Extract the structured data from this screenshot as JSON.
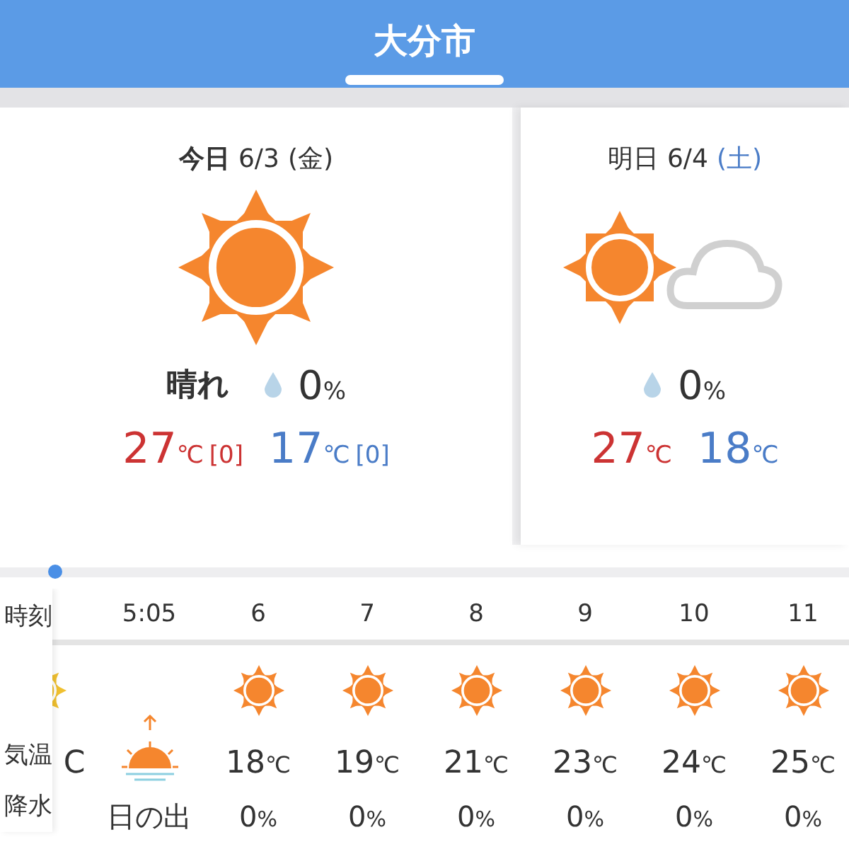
{
  "header": {
    "title": "大分市"
  },
  "days": [
    {
      "label": "今日",
      "date": "6/3",
      "weekday": "(金)",
      "color": "#333333",
      "kind": "sunny",
      "weather": "晴れ",
      "precip": "0",
      "precip_unit": "%",
      "high": "27",
      "high_unit": "℃",
      "high_diff": "[0]",
      "low": "17",
      "low_unit": "℃",
      "low_diff": "[0]"
    },
    {
      "label": "明日",
      "date": "6/4",
      "weekday": "(土)",
      "color": "#4a7cc7",
      "kind": "sunny_then_cloudy",
      "precip": "0",
      "precip_unit": "%",
      "high": "27",
      "high_unit": "℃",
      "low": "18",
      "low_unit": "℃"
    }
  ],
  "timeline": {
    "level": 0.065
  },
  "hourly": {
    "row_labels": {
      "time": "時刻",
      "temp": "気温",
      "precip": "降水"
    },
    "hidden_column": {
      "temp_unit": "C"
    },
    "columns": [
      {
        "kind": "sunrise",
        "time": "5:05",
        "precip": "日の出"
      },
      {
        "kind": "hour",
        "time": "6",
        "temp": "18",
        "temp_unit": "℃",
        "precip": "0",
        "precip_unit": "%"
      },
      {
        "kind": "hour",
        "time": "7",
        "temp": "19",
        "temp_unit": "℃",
        "precip": "0",
        "precip_unit": "%"
      },
      {
        "kind": "hour",
        "time": "8",
        "temp": "21",
        "temp_unit": "℃",
        "precip": "0",
        "precip_unit": "%"
      },
      {
        "kind": "hour",
        "time": "9",
        "temp": "23",
        "temp_unit": "℃",
        "precip": "0",
        "precip_unit": "%"
      },
      {
        "kind": "hour",
        "time": "10",
        "temp": "24",
        "temp_unit": "℃",
        "precip": "0",
        "precip_unit": "%"
      },
      {
        "kind": "hour",
        "time": "11",
        "temp": "25",
        "temp_unit": "℃",
        "precip": "0",
        "precip_unit": "%"
      }
    ]
  }
}
